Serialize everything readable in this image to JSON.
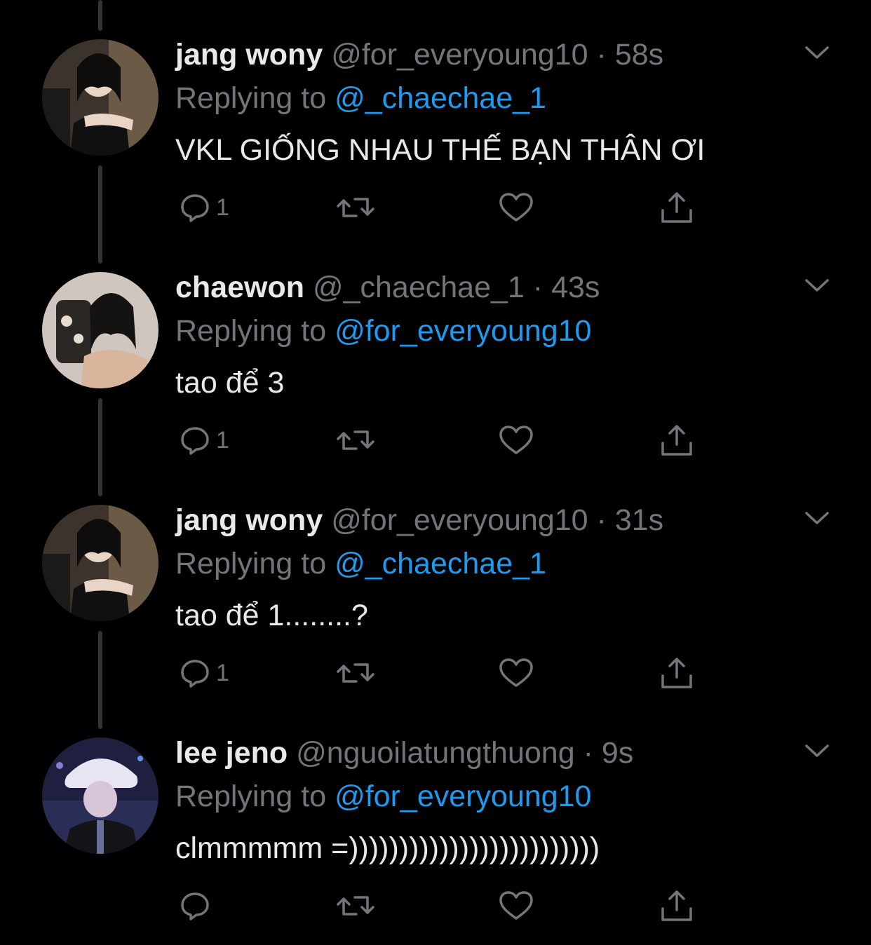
{
  "theme": {
    "background": "#000000",
    "text_primary": "#e7e9ea",
    "text_secondary": "#71767b",
    "link": "#1d9bf0",
    "thread_line": "#2f3336"
  },
  "tweets": [
    {
      "name": "jang wony",
      "handle": "@for_everyoung10",
      "dot": "·",
      "time": "58s",
      "replying_prefix": "Replying to ",
      "replying_to": "@_chaechae_1",
      "text": "VKL GIỐNG NHAU THẾ BẠN THÂN ƠI",
      "reply_count": "1",
      "avatar": "avatar-photo"
    },
    {
      "name": "chaewon",
      "handle": "@_chaechae_1",
      "dot": "·",
      "time": "43s",
      "replying_prefix": "Replying to ",
      "replying_to": "@for_everyoung10",
      "text": "tao để 3",
      "reply_count": "1",
      "avatar": "avatar-photo"
    },
    {
      "name": "jang wony",
      "handle": "@for_everyoung10",
      "dot": "·",
      "time": "31s",
      "replying_prefix": "Replying to ",
      "replying_to": "@_chaechae_1",
      "text": "tao để 1........?",
      "reply_count": "1",
      "avatar": "avatar-photo"
    },
    {
      "name": "lee jeno",
      "handle": "@nguoilatungthuong",
      "dot": "·",
      "time": "9s",
      "replying_prefix": "Replying to ",
      "replying_to": "@for_everyoung10",
      "text": "clmmmmm =)))))))))))))))))))))))))",
      "reply_count": "",
      "avatar": "avatar-photo"
    }
  ],
  "icons": {
    "reply": "reply-icon",
    "retweet": "retweet-icon",
    "like": "heart-icon",
    "share": "share-icon",
    "more": "chevron-down-icon"
  }
}
